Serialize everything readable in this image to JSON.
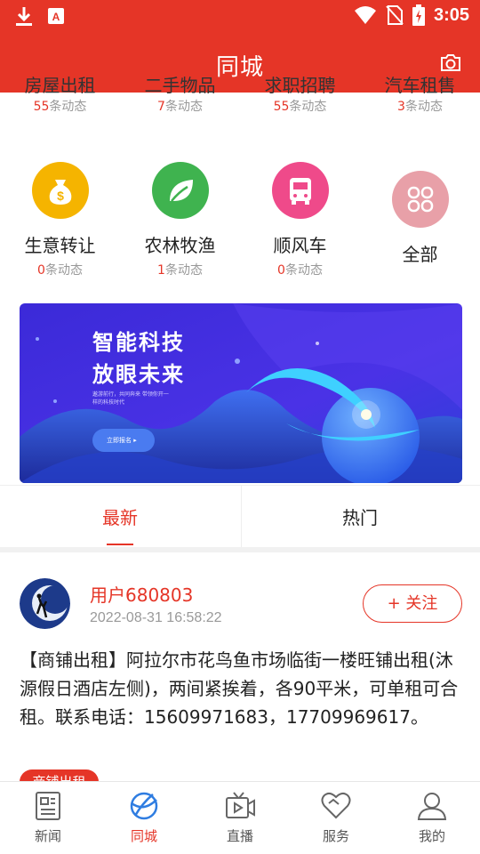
{
  "status_bar": {
    "time": "3:05"
  },
  "header": {
    "title": "同城"
  },
  "categories_row1": [
    {
      "label": "房屋出租",
      "count": "55",
      "unit": "条动态"
    },
    {
      "label": "二手物品",
      "count": "7",
      "unit": "条动态"
    },
    {
      "label": "求职招聘",
      "count": "55",
      "unit": "条动态"
    },
    {
      "label": "汽车租售",
      "count": "3",
      "unit": "条动态"
    }
  ],
  "categories_row2": [
    {
      "label": "生意转让",
      "count": "0",
      "unit": "条动态",
      "icon": "money-bag-icon",
      "color": "#f5b400"
    },
    {
      "label": "农林牧渔",
      "count": "1",
      "unit": "条动态",
      "icon": "leaf-icon",
      "color": "#3fb34f"
    },
    {
      "label": "顺风车",
      "count": "0",
      "unit": "条动态",
      "icon": "bus-icon",
      "color": "#ef4a8a"
    },
    {
      "label": "全部",
      "icon": "clover-icon",
      "color": "#e8a0a8"
    }
  ],
  "banner": {
    "line1": "智能科技",
    "line2": "放眼未来",
    "small_text": "遨游前行，共同奔来 带领你开一样的科技时代",
    "button": "立即报名"
  },
  "tabs": [
    {
      "label": "最新",
      "active": true
    },
    {
      "label": "热门",
      "active": false
    }
  ],
  "post": {
    "username": "用户680803",
    "time": "2022-08-31 16:58:22",
    "follow": "+ 关注",
    "text": "【商铺出租】阿拉尔市花鸟鱼市场临街一楼旺铺出租(沐源假日酒店左侧)，两间紧挨着，各90平米，可单租可合租。联系电话：15609971683，17709969617。",
    "tag": "商铺出租"
  },
  "bottom_nav": [
    {
      "label": "新闻",
      "icon": "news-icon",
      "active": false
    },
    {
      "label": "同城",
      "icon": "city-icon",
      "active": true
    },
    {
      "label": "直播",
      "icon": "live-tv-icon",
      "active": false
    },
    {
      "label": "服务",
      "icon": "heart-service-icon",
      "active": false
    },
    {
      "label": "我的",
      "icon": "profile-icon",
      "active": false
    }
  ],
  "colors": {
    "brand_red": "#e53527",
    "muted": "#999999"
  }
}
